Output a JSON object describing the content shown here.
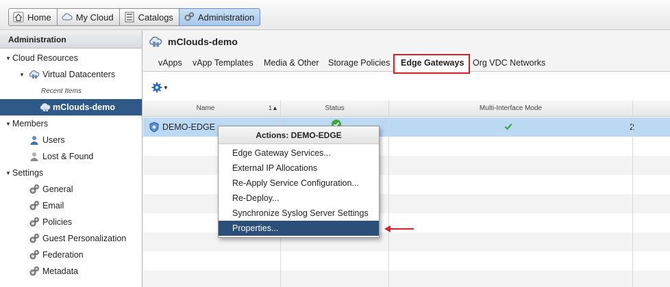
{
  "nav": {
    "tabs": [
      {
        "label": "Home",
        "icon": "home-icon"
      },
      {
        "label": "My Cloud",
        "icon": "cloud-icon"
      },
      {
        "label": "Catalogs",
        "icon": "catalog-icon"
      },
      {
        "label": "Administration",
        "icon": "administration-icon",
        "active": true
      }
    ]
  },
  "sidebar": {
    "header": "Administration",
    "cloud_resources": "Cloud Resources",
    "virtual_datacenters": "Virtual Datacenters",
    "recent_items": "Recent Items",
    "selected_vdc": "mClouds-demo",
    "members": "Members",
    "users": "Users",
    "lost_found": "Lost & Found",
    "settings": "Settings",
    "settings_items": [
      "General",
      "Email",
      "Policies",
      "Guest Personalization",
      "Federation",
      "Metadata"
    ]
  },
  "content": {
    "title": "mClouds-demo",
    "tabs": [
      "vApps",
      "vApp Templates",
      "Media & Other",
      "Storage Policies",
      "Edge Gateways",
      "Org VDC Networks"
    ],
    "active_tab": "Edge Gateways"
  },
  "grid": {
    "columns": {
      "name": "Name",
      "sort": "1▲",
      "status": "Status",
      "multi_interface": "Multi-Interface Mode"
    },
    "row": {
      "name": "DEMO-EDGE",
      "status_icon": "check-icon",
      "multi_interface_icon": "check-icon",
      "count": "2"
    }
  },
  "menu": {
    "title": "Actions: DEMO-EDGE",
    "items": [
      "Edge Gateway Services...",
      "External IP Allocations",
      "Re-Apply Service Configuration...",
      "Re-Deploy...",
      "Synchronize Syslog Server Settings",
      "Properties..."
    ],
    "active_index": 5
  },
  "colors": {
    "selection_blue": "#2f5a88",
    "row_highlight": "#bcd9f3",
    "annotation_red": "#d2232a",
    "check_green": "#3aa83a"
  }
}
